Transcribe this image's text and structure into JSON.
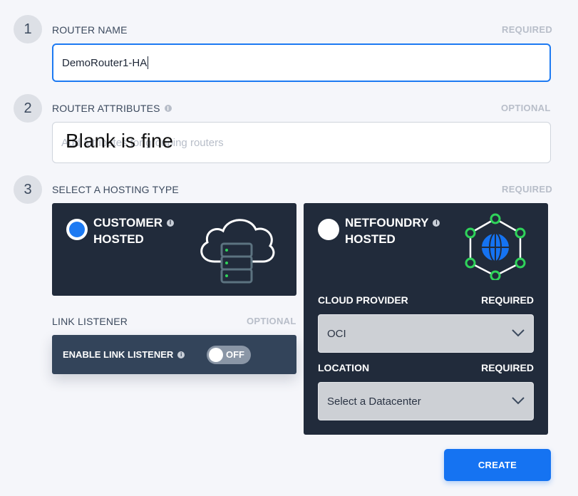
{
  "steps": [
    {
      "number": "1",
      "label": "ROUTER NAME",
      "tag": "REQUIRED"
    },
    {
      "number": "2",
      "label": "ROUTER ATTRIBUTES",
      "tag": "OPTIONAL"
    },
    {
      "number": "3",
      "label": "SELECT A HOSTING TYPE",
      "tag": "REQUIRED"
    }
  ],
  "router_name": {
    "value": "DemoRouter1-HA"
  },
  "router_attributes": {
    "placeholder": "Add attributes for grouping routers",
    "overlay_text": "Blank is fine"
  },
  "hosting": {
    "customer": {
      "line1": "CUSTOMER",
      "line2": "HOSTED",
      "selected": true,
      "icon": "cloud-server-icon"
    },
    "netfoundry": {
      "line1": "NETFOUNDRY",
      "line2": "HOSTED",
      "selected": false,
      "icon": "globe-network-icon"
    }
  },
  "link_listener": {
    "label": "LINK LISTENER",
    "tag": "OPTIONAL",
    "toggle_label": "ENABLE LINK LISTENER",
    "toggle_state": "OFF"
  },
  "cloud_provider": {
    "label": "CLOUD PROVIDER",
    "tag": "REQUIRED",
    "value": "OCI"
  },
  "location": {
    "label": "LOCATION",
    "tag": "REQUIRED",
    "value": "Select a Datacenter"
  },
  "actions": {
    "create_label": "CREATE"
  },
  "colors": {
    "accent": "#1573f2",
    "card_bg": "#212b3b",
    "network_green": "#2fd35a"
  }
}
